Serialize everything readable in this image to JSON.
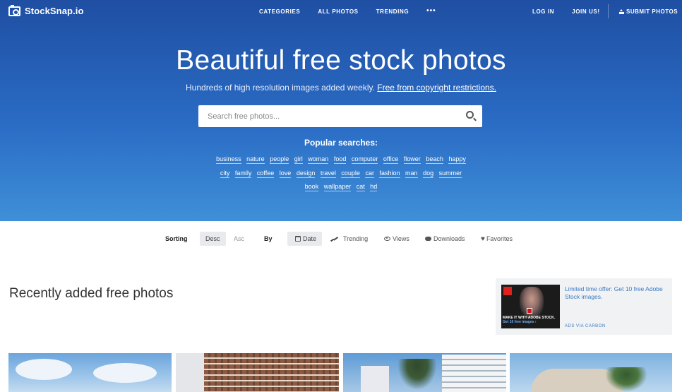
{
  "brand": {
    "logo_text": "StockSnap.io"
  },
  "nav": {
    "center": [
      "CATEGORIES",
      "ALL PHOTOS",
      "TRENDING"
    ],
    "more": "•••",
    "login": "LOG IN",
    "join": "JOIN US!",
    "submit": "SUBMIT PHOTOS"
  },
  "hero": {
    "title": "Beautiful free stock photos",
    "subtitle": "Hundreds of high resolution images added weekly.",
    "subtitle_link": "Free from copyright restrictions.",
    "search_placeholder": "Search free photos...",
    "popular_label": "Popular searches:",
    "tags": [
      "business",
      "nature",
      "people",
      "girl",
      "woman",
      "food",
      "computer",
      "office",
      "flower",
      "beach",
      "happy",
      "city",
      "family",
      "coffee",
      "love",
      "design",
      "travel",
      "couple",
      "car",
      "fashion",
      "man",
      "dog",
      "summer",
      "book",
      "wallpaper",
      "cat",
      "hd"
    ]
  },
  "sort": {
    "sorting_label": "Sorting",
    "desc": "Desc",
    "asc": "Asc",
    "by_label": "By",
    "date": "Date",
    "trending": "Trending",
    "views": "Views",
    "downloads": "Downloads",
    "favorites": "Favorites"
  },
  "section": {
    "title": "Recently added free photos"
  },
  "ad": {
    "copy": "Limited time offer: Get 10 free Adobe Stock images.",
    "via": "ADS VIA CARBON",
    "image_text": "MAKE IT WITH ADOBE STOCK.",
    "image_cta": "Get 10 free images ›"
  },
  "colors": {
    "hero_top": "#1f4fa3",
    "hero_bottom": "#3f8fd8",
    "ad_link": "#3a7ac4"
  }
}
